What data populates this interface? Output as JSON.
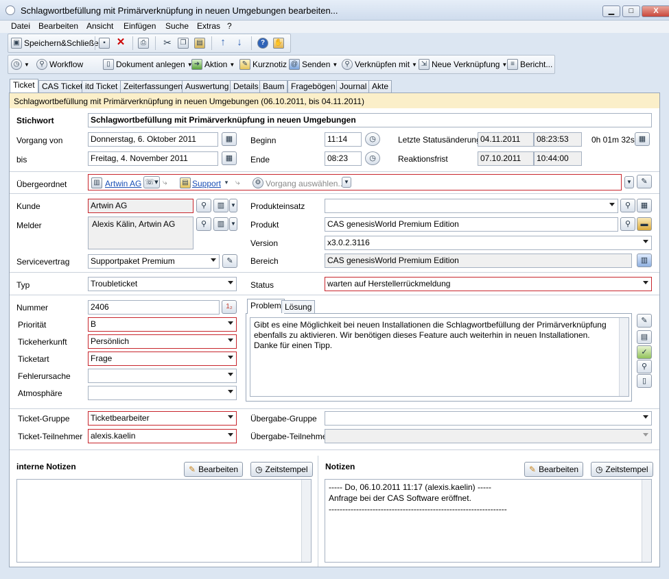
{
  "window": {
    "title": "Schlagwortbefüllung mit Primärverknüpfung in neuen Umgebungen bearbeiten...",
    "minimize": "▁",
    "maximize": "□",
    "close": "X"
  },
  "menu": [
    "Datei",
    "Bearbeiten",
    "Ansicht",
    "Einfügen",
    "Suche",
    "Extras",
    "?"
  ],
  "toolbar1": {
    "save_close": "Speichern&Schließen"
  },
  "toolbar2": {
    "workflow": "Workflow",
    "dokument_anlegen": "Dokument anlegen",
    "aktion": "Aktion",
    "kurznotiz": "Kurznotiz",
    "senden": "Senden",
    "verknuepfen_mit": "Verknüpfen mit",
    "neue_verknuepfung": "Neue Verknüpfung",
    "bericht": "Bericht..."
  },
  "tabs": [
    "Ticket",
    "CAS Ticket",
    "itd Ticket",
    "Zeiterfassungen",
    "Auswertung",
    "Details",
    "Baum",
    "Fragebögen",
    "Journal",
    "Akte"
  ],
  "infobar": "Schlagwortbefüllung mit Primärverknüpfung in neuen Umgebungen (06.10.2011, bis 04.11.2011)",
  "form": {
    "stichwort_label": "Stichwort",
    "stichwort": "Schlagwortbefüllung mit Primärverknüpfung in neuen Umgebungen",
    "vorgang_von_label": "Vorgang von",
    "vorgang_von": "Donnerstag, 6. Oktober 2011",
    "bis_label": "bis",
    "bis": "Freitag, 4. November 2011",
    "beginn_label": "Beginn",
    "beginn": "11:14",
    "ende_label": "Ende",
    "ende": "08:23",
    "letzte_status_label": "Letzte Statusänderung",
    "letzte_status_date": "04.11.2011",
    "letzte_status_time": "08:23:53",
    "duration": "0h 01m 32s",
    "reaktionsfrist_label": "Reaktionsfrist",
    "reaktionsfrist_date": "07.10.2011",
    "reaktionsfrist_time": "10:44:00",
    "uebergeordnet_label": "Übergeordnet",
    "uebergeordnet_link1": "Artwin AG",
    "uebergeordnet_link2": "Support",
    "uebergeordnet_placeholder": "Vorgang auswählen...",
    "kunde_label": "Kunde",
    "kunde": "Artwin AG",
    "melder_label": "Melder",
    "melder": "Alexis Kälin, Artwin AG",
    "servicevertrag_label": "Servicevertrag",
    "servicevertrag": "Supportpaket Premium",
    "produkteinsatz_label": "Produkteinsatz",
    "produkteinsatz": "",
    "produkt_label": "Produkt",
    "produkt": "CAS genesisWorld Premium Edition",
    "version_label": "Version",
    "version": "x3.0.2.3116",
    "bereich_label": "Bereich",
    "bereich": "CAS genesisWorld Premium Edition",
    "typ_label": "Typ",
    "typ": "Troubleticket",
    "status_label": "Status",
    "status": "warten auf Herstellerrückmeldung",
    "nummer_label": "Nummer",
    "nummer": "2406",
    "prioritaet_label": "Priorität",
    "prioritaet": "B",
    "tickeherkunft_label": "Tickeherkunft",
    "tickeherkunft": "Persönlich",
    "ticketart_label": "Ticketart",
    "ticketart": "Frage",
    "fehlerursache_label": "Fehlerursache",
    "fehlerursache": "",
    "atmosphaere_label": "Atmosphäre",
    "atmosphaere": "",
    "problem_tab": "Problem",
    "loesung_tab": "Lösung",
    "problem_text": "Gibt es eine Möglichkeit bei neuen Installationen die Schlagwortbefüllung der Primärverknüpfung ebenfalls zu aktivieren. Wir benötigen dieses Feature auch weiterhin in neuen Installationen. Danke für einen Tipp.",
    "ticket_gruppe_label": "Ticket-Gruppe",
    "ticket_gruppe": "Ticketbearbeiter",
    "ticket_teilnehmer_label": "Ticket-Teilnehmer",
    "ticket_teilnehmer": "alexis.kaelin",
    "uebergabe_gruppe_label": "Übergabe-Gruppe",
    "uebergabe_gruppe": "",
    "uebergabe_teilnehmer_label": "Übergabe-Teilnehmer",
    "uebergabe_teilnehmer": ""
  },
  "notes": {
    "interne_label": "interne Notizen",
    "notizen_label": "Notizen",
    "bearbeiten": "Bearbeiten",
    "zeitstempel": "Zeitstempel",
    "notiz_line1": "----- Do, 06.10.2011 11:17 (alexis.kaelin) -----",
    "notiz_line2": "Anfrage bei der CAS Software eröffnet.",
    "notiz_line3": "-----------------------------------------------------------------"
  }
}
